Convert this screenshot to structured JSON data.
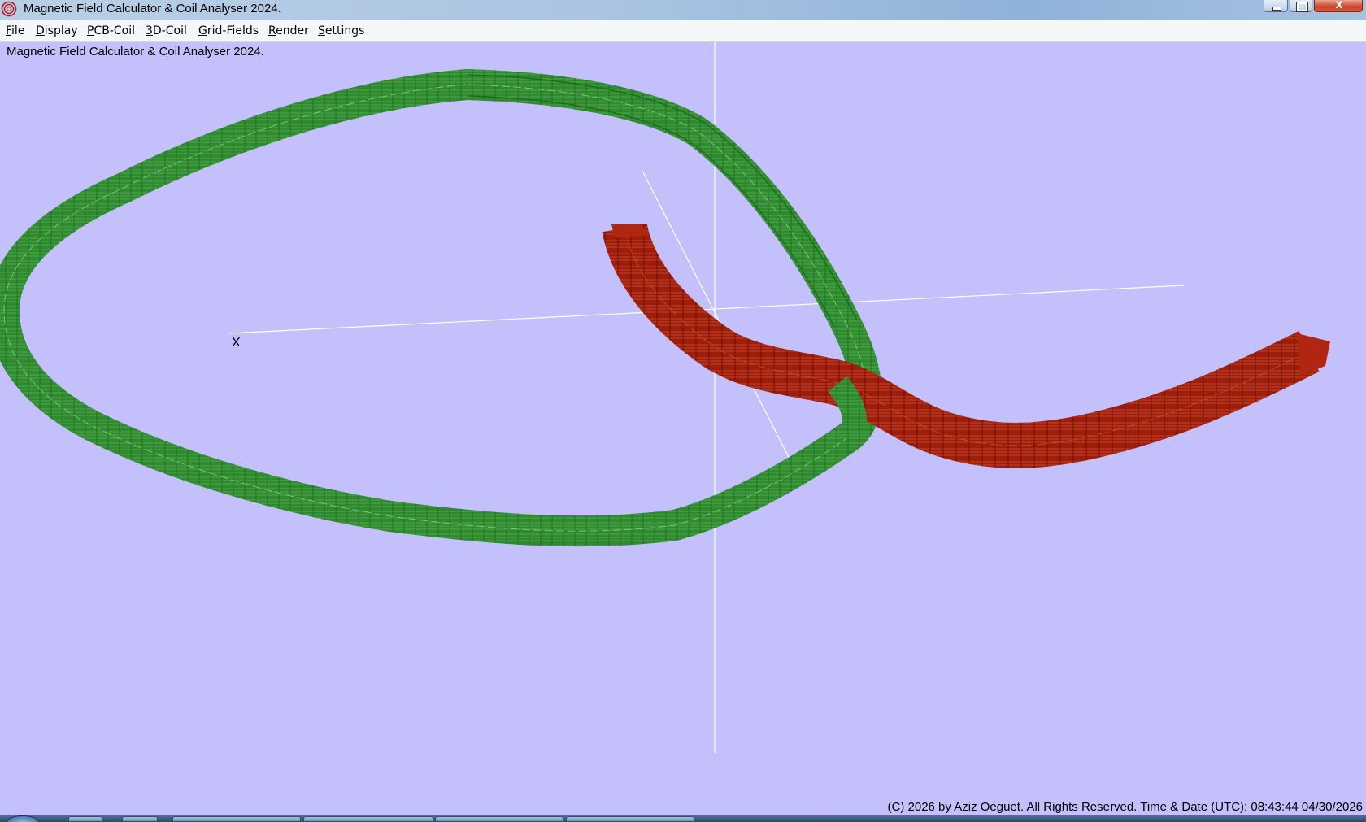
{
  "window": {
    "title": "Magnetic Field Calculator & Coil Analyser 2024.",
    "close_glyph": "x"
  },
  "menu": {
    "items": [
      {
        "first": "F",
        "rest": "ile"
      },
      {
        "first": "D",
        "rest": "isplay"
      },
      {
        "first": "P",
        "rest": "CB-Coil"
      },
      {
        "first": "3",
        "rest": "D-Coil"
      },
      {
        "first": "G",
        "rest": "rid-Fields"
      },
      {
        "first": "R",
        "rest": "ender"
      },
      {
        "first": "S",
        "rest": "ettings"
      }
    ]
  },
  "viewport": {
    "label": "Magnetic Field Calculator & Coil Analyser 2024.",
    "axis_label_x": "X",
    "background": "#c3c0fc",
    "coil_green_color": "#2e8b2e",
    "coil_red_color": "#9e1e0c",
    "axis_color": "#ffffff"
  },
  "status": {
    "copyright": "(C) 2026  by Aziz Oeguet. All Rights Reserved.  Time & Date (UTC): 08:43:44  04/30/2026"
  },
  "icons": {
    "app": "app-coil-icon",
    "minimize": "minimize-icon",
    "maximize": "maximize-icon",
    "close": "close-icon",
    "start": "start-orb-icon"
  }
}
